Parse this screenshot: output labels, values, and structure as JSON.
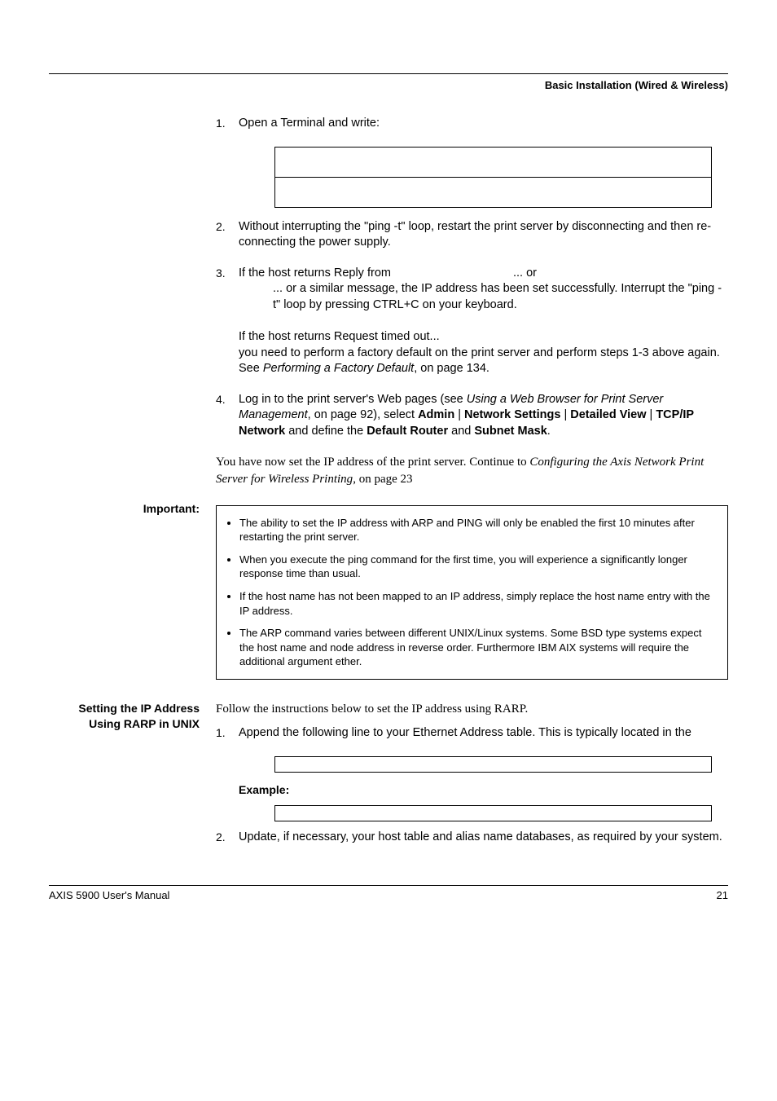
{
  "header": {
    "section": "Basic Installation (Wired & Wireless)"
  },
  "steps_a": {
    "s1": {
      "num": "1.",
      "text": "Open a Terminal and write:"
    },
    "s2": {
      "num": "2.",
      "text": "Without interrupting the \"ping -t\" loop, restart the print server by disconnecting and then re-connecting the power supply."
    },
    "s3": {
      "num": "3.",
      "line1a": "If the host returns Reply from",
      "line1b": "... or",
      "line2": "... or a similar message, the IP address has been set successfully. Interrupt the \"ping -t\" loop by pressing CTRL+C on your keyboard.",
      "para2a": "If the host returns Request timed out...",
      "para2b": "you need to perform a factory default on the print server and perform steps 1-3 above again.",
      "para2c_pre": "See ",
      "para2c_em": "Performing a Factory Default",
      "para2c_post": ", on page 134."
    },
    "s4": {
      "num": "4.",
      "pre": "Log in to the print server's Web pages (see ",
      "em": "Using a Web Browser for Print Server Management",
      "mid": ", on page 92), select ",
      "b1": "Admin",
      "sep": " | ",
      "b2": "Network Settings",
      "b3": "Detailed View",
      "b4": "TCP/IP Network",
      "mid2": " and define the ",
      "b5": "Default Router",
      "mid3": " and ",
      "b6": "Subnet Mask",
      "end": "."
    }
  },
  "closing": {
    "pre": "You have now set the IP address of the print server. Continue to ",
    "em": "Configuring the Axis Network Print Server for Wireless Printing",
    "post": ", on page 23"
  },
  "important": {
    "label": "Important:",
    "bullets": [
      "The ability to set the IP address with ARP and PING will only be enabled the first 10 minutes after restarting the print server.",
      "When you execute the ping command for the first time, you will experience a significantly longer response time than usual.",
      "If the host name has not been mapped to an IP address, simply replace the host name entry with the IP address.",
      "The ARP command varies between different UNIX/Linux systems. Some BSD type systems expect the host name and node address in reverse order. Furthermore IBM AIX systems will require the additional argument ether."
    ]
  },
  "rarp": {
    "heading": "Setting the IP Address Using RARP in UNIX",
    "intro": "Follow the instructions below to set the IP address using RARP.",
    "s1": {
      "num": "1.",
      "text": "Append the following line to your Ethernet Address table. This is typically located in the"
    },
    "example_label": "Example:",
    "s2": {
      "num": "2.",
      "text": "Update, if necessary, your host table and alias name databases, as required by your system."
    }
  },
  "footer": {
    "left": "AXIS 5900 User's Manual",
    "right": "21"
  }
}
